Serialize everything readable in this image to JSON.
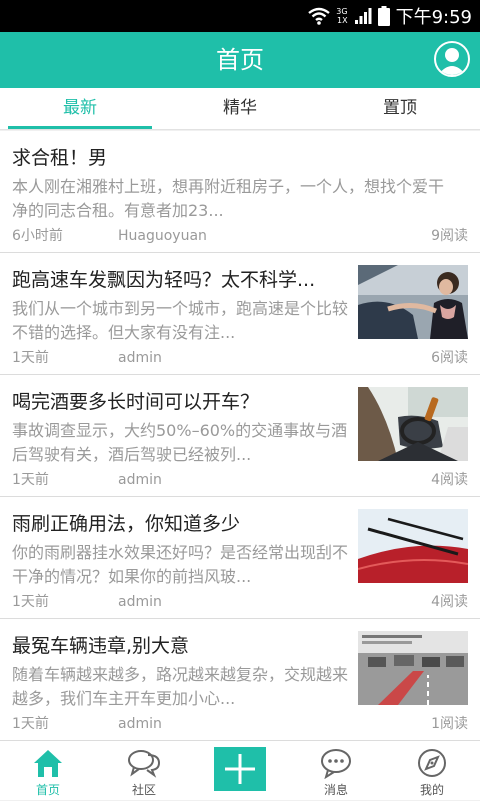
{
  "status_bar": {
    "network_top": "3G",
    "network_bottom": "1X",
    "time": "下午9:59"
  },
  "header": {
    "title": "首页"
  },
  "tabs": [
    {
      "label": "最新",
      "active": true
    },
    {
      "label": "精华",
      "active": false
    },
    {
      "label": "置顶",
      "active": false
    }
  ],
  "articles": [
    {
      "title": "求合租！男",
      "snippet": "本人刚在湘雅村上班，想再附近租房子，一个人，想找个爱干净的同志合租。有意者加23...",
      "time": "6小时前",
      "author": "Huaguoyuan",
      "reads": "9阅读",
      "has_thumb": false
    },
    {
      "title": "跑高速车发飘因为轻吗？太不科学...",
      "snippet": "我们从一个城市到另一个城市，跑高速是个比较不错的选择。但大家有没有注...",
      "time": "1天前",
      "author": "admin",
      "reads": "6阅读",
      "has_thumb": true,
      "thumb": "woman-driving-car-photo"
    },
    {
      "title": "喝完酒要多长时间可以开车？",
      "snippet": "事故调查显示，大约50%–60%的交通事故与酒后驾驶有关，酒后驾驶已经被列...",
      "time": "1天前",
      "author": "admin",
      "reads": "4阅读",
      "has_thumb": true,
      "thumb": "drinking-while-driving-photo"
    },
    {
      "title": "雨刷正确用法，你知道多少",
      "snippet": "你的雨刷器挂水效果还好吗？是否经常出现刮不干净的情况？如果你的前挡风玻...",
      "time": "1天前",
      "author": "admin",
      "reads": "4阅读",
      "has_thumb": true,
      "thumb": "windshield-wiper-photo"
    },
    {
      "title": "最冤车辆违章,别大意",
      "snippet": "随着车辆越来越多，路况越来越复杂，交规越来越多，我们车主开车更加小心...",
      "time": "1天前",
      "author": "admin",
      "reads": "1阅读",
      "has_thumb": true,
      "thumb": "traffic-violation-road-photo"
    }
  ],
  "bottom_nav": [
    {
      "label": "首页",
      "icon": "home-icon",
      "active": true
    },
    {
      "label": "社区",
      "icon": "chat-bubbles-icon",
      "active": false
    },
    {
      "label": "",
      "icon": "plus-icon",
      "active": false
    },
    {
      "label": "消息",
      "icon": "message-icon",
      "active": false
    },
    {
      "label": "我的",
      "icon": "compass-icon",
      "active": false
    }
  ],
  "colors": {
    "accent": "#1fbfa9",
    "status_bar": "#000000",
    "background": "#f0f0f0"
  }
}
